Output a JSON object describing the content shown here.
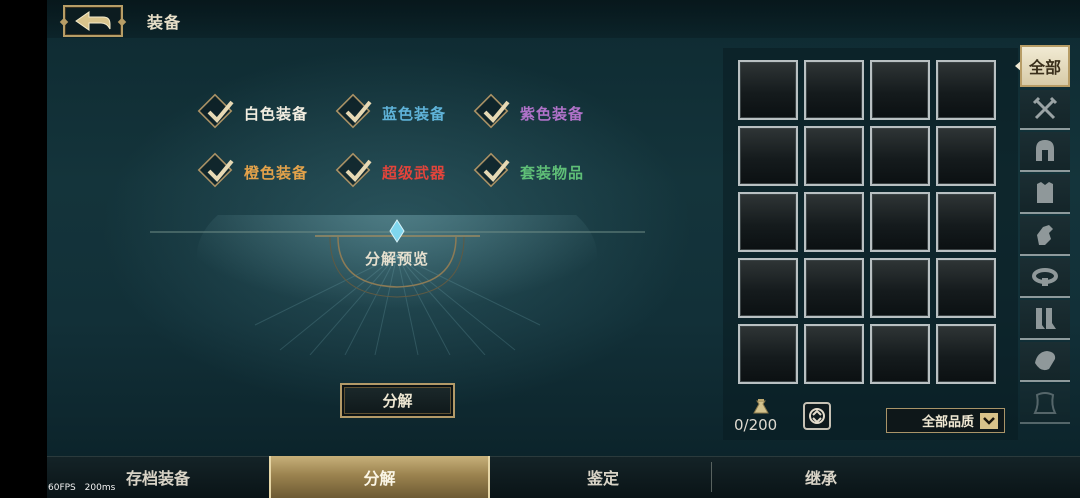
{
  "header": {
    "title": "装备",
    "back_icon": "back-arrow-icon"
  },
  "filters": [
    {
      "label": "白色装备",
      "color": "#f2ede0",
      "checked": true
    },
    {
      "label": "蓝色装备",
      "color": "#5fb3d9",
      "checked": true
    },
    {
      "label": "紫色装备",
      "color": "#b072c9",
      "checked": true
    },
    {
      "label": "橙色装备",
      "color": "#e3a24a",
      "checked": true
    },
    {
      "label": "超级武器",
      "color": "#e2443b",
      "checked": true
    },
    {
      "label": "套装物品",
      "color": "#5fbf77",
      "checked": true
    }
  ],
  "preview": {
    "label": "分解预览"
  },
  "actions": {
    "decompose_label": "分解"
  },
  "inventory": {
    "rows": 5,
    "columns": 4,
    "capacity": "0/200",
    "bag_icon": "bag-icon",
    "sort_icon": "sort-icon",
    "quality_filter": "全部品质"
  },
  "categories": {
    "active_label": "全部",
    "icons": [
      "crossed-swords-icon",
      "helmet-icon",
      "armor-icon",
      "gauntlet-icon",
      "belt-icon",
      "boots-icon",
      "bracer-icon",
      "cape-icon"
    ]
  },
  "bottom_tabs": [
    {
      "label": "存档装备",
      "active": false
    },
    {
      "label": "分解",
      "active": true
    },
    {
      "label": "鉴定",
      "active": false
    },
    {
      "label": "继承",
      "active": false
    }
  ],
  "debug": {
    "fps": "60FPS",
    "latency": "200ms"
  },
  "colors": {
    "gold": "#b79d66",
    "accent": "#d8c28a"
  }
}
